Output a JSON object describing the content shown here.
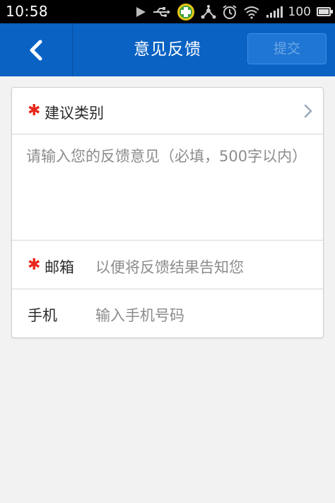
{
  "status_bar": {
    "time": "10:58",
    "icons": [
      "play-icon",
      "usb-icon",
      "app-360-icon",
      "share-network-icon",
      "alarm-icon",
      "wifi-icon",
      "signal-icon"
    ],
    "battery_text": "100",
    "battery_level": 1.0
  },
  "navbar": {
    "title": "意见反馈",
    "submit_label": "提交",
    "background": "#0a62c3"
  },
  "form": {
    "category": {
      "required_mark": "✱",
      "label": "建议类别"
    },
    "feedback": {
      "placeholder": "请输入您的反馈意见（必填，500字以内）"
    },
    "email": {
      "required_mark": "✱",
      "label": "邮箱",
      "placeholder": "以便将反馈结果告知您"
    },
    "phone": {
      "label": "手机",
      "placeholder": "输入手机号码"
    }
  },
  "colors": {
    "required": "#e8271c",
    "placeholder": "#8c8c8c"
  }
}
